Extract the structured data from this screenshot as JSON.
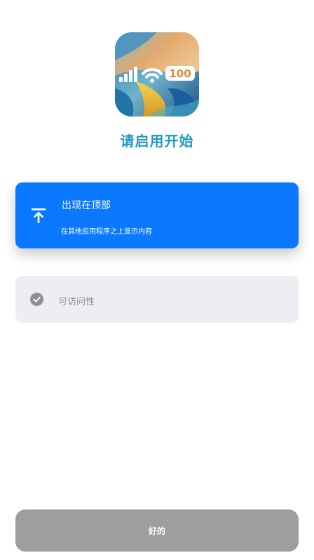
{
  "app_icon": {
    "name": "app-icon",
    "battery_text": "100"
  },
  "title": "请启用开始",
  "options": {
    "overlay": {
      "icon": "arrow-to-top-icon",
      "label": "出现在顶部",
      "description": "在其他应用程序之上显示内容",
      "color": "#0a79ff"
    },
    "accessibility": {
      "icon": "check-circle-icon",
      "label": "可访问性"
    }
  },
  "footer": {
    "ok_label": "好的"
  }
}
